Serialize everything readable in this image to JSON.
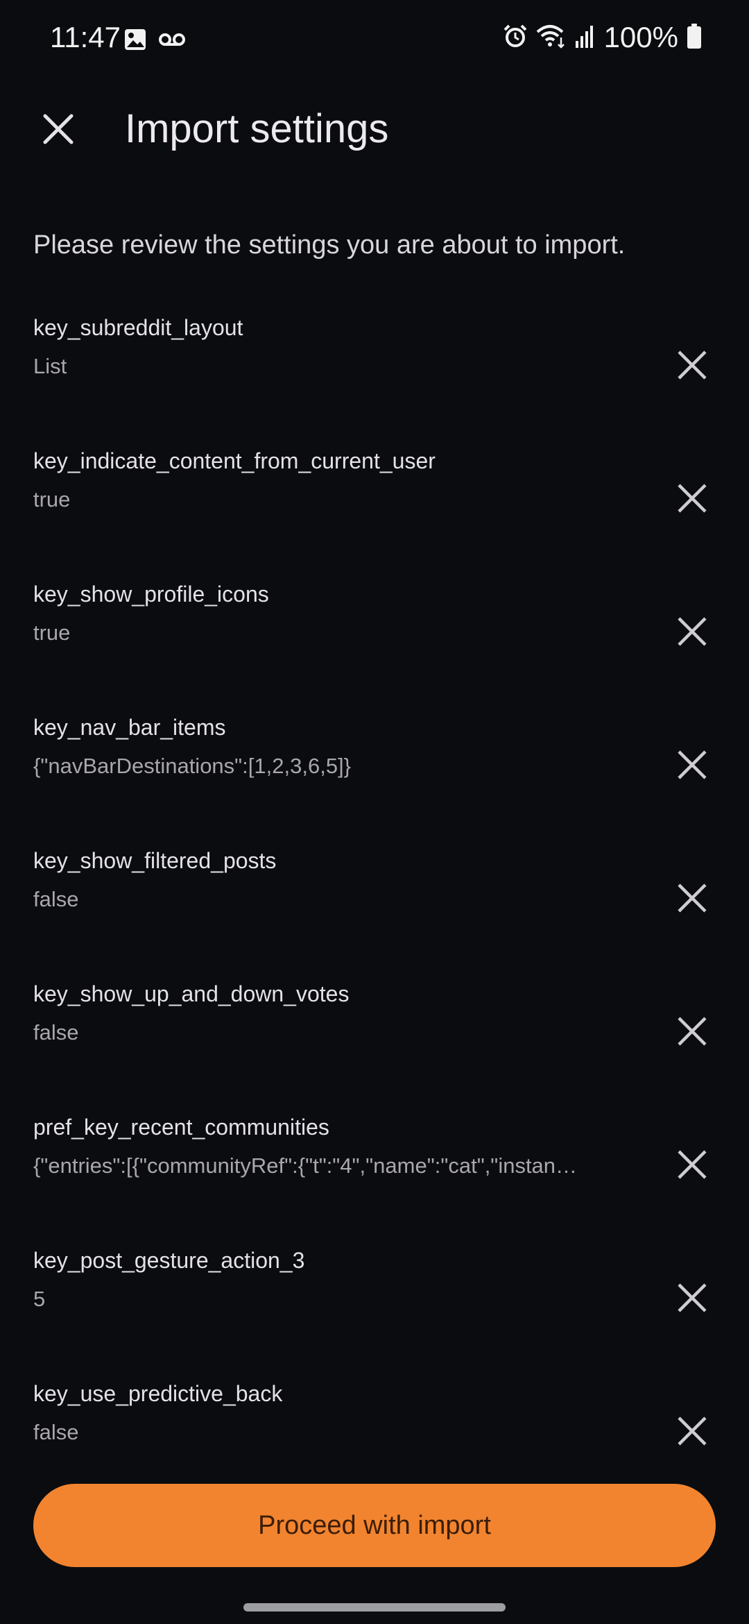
{
  "status_bar": {
    "time": "11:47",
    "battery": "100%",
    "icons": [
      "image-icon",
      "voicemail-icon",
      "alarm-icon",
      "wifi-icon",
      "signal-icon",
      "battery-icon"
    ]
  },
  "app_bar": {
    "title": "Import settings",
    "close_icon": "close-icon"
  },
  "description": "Please review the settings you are about to import.",
  "settings": [
    {
      "key": "key_subreddit_layout",
      "value": "List"
    },
    {
      "key": "key_indicate_content_from_current_user",
      "value": "true"
    },
    {
      "key": "key_show_profile_icons",
      "value": "true"
    },
    {
      "key": "key_nav_bar_items",
      "value": "{\"navBarDestinations\":[1,2,3,6,5]}"
    },
    {
      "key": "key_show_filtered_posts",
      "value": "false"
    },
    {
      "key": "key_show_up_and_down_votes",
      "value": "false"
    },
    {
      "key": "pref_key_recent_communities",
      "value": "{\"entries\":[{\"communityRef\":{\"t\":\"4\",\"name\":\"cat\",\"instan…"
    },
    {
      "key": "key_post_gesture_action_3",
      "value": "5"
    },
    {
      "key": "key_use_predictive_back",
      "value": "false"
    }
  ],
  "proceed_button": {
    "label": "Proceed with import"
  },
  "colors": {
    "background": "#0b0c0f",
    "accent": "#f28430",
    "accent_text": "#3b1d08",
    "primary_text": "#e4e2e8",
    "secondary_text": "#a9a7ad"
  }
}
